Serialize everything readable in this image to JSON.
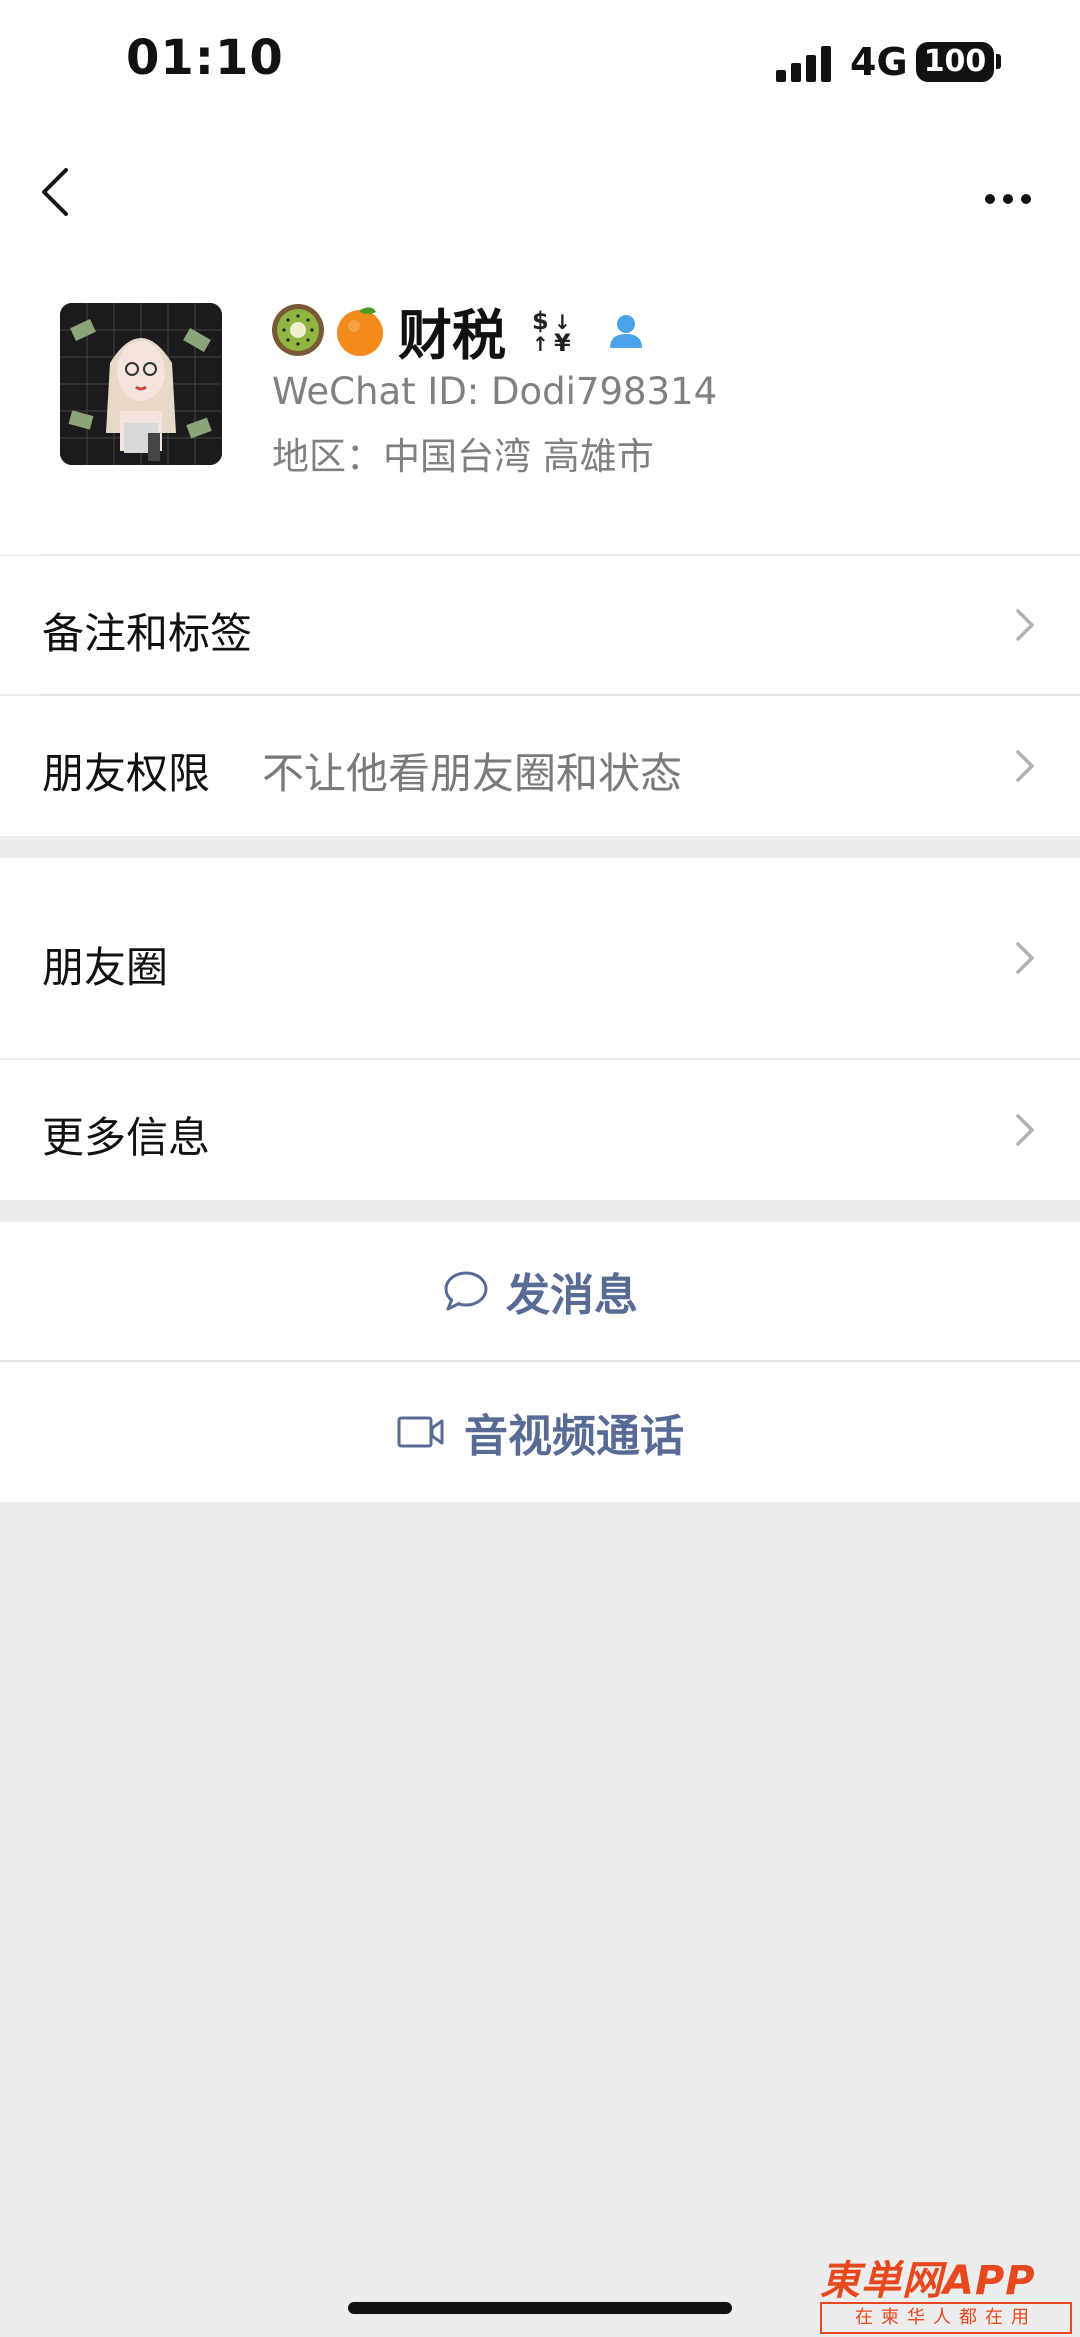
{
  "status_bar": {
    "time": "01:10",
    "network": "4G",
    "battery": "100"
  },
  "profile": {
    "name": "财税",
    "emojis": [
      "kiwi-emoji",
      "tangerine-emoji"
    ],
    "wechat_id": "WeChat ID: Dodi798314",
    "region": "地区：中国台湾 高雄市"
  },
  "settings_group_1": [
    {
      "label": "备注和标签",
      "value": ""
    },
    {
      "label": "朋友权限",
      "value": "不让他看朋友圈和状态"
    }
  ],
  "settings_group_2": [
    {
      "label": "朋友圈",
      "value": ""
    },
    {
      "label": "更多信息",
      "value": ""
    }
  ],
  "actions": {
    "message": "发消息",
    "call": "音视频通话"
  },
  "watermark": {
    "brand": "東単网APP",
    "slogan": "在柬华人都在用"
  },
  "colors": {
    "link_blue": "#576b95",
    "background": "#ededed",
    "watermark": "#e8481d"
  }
}
